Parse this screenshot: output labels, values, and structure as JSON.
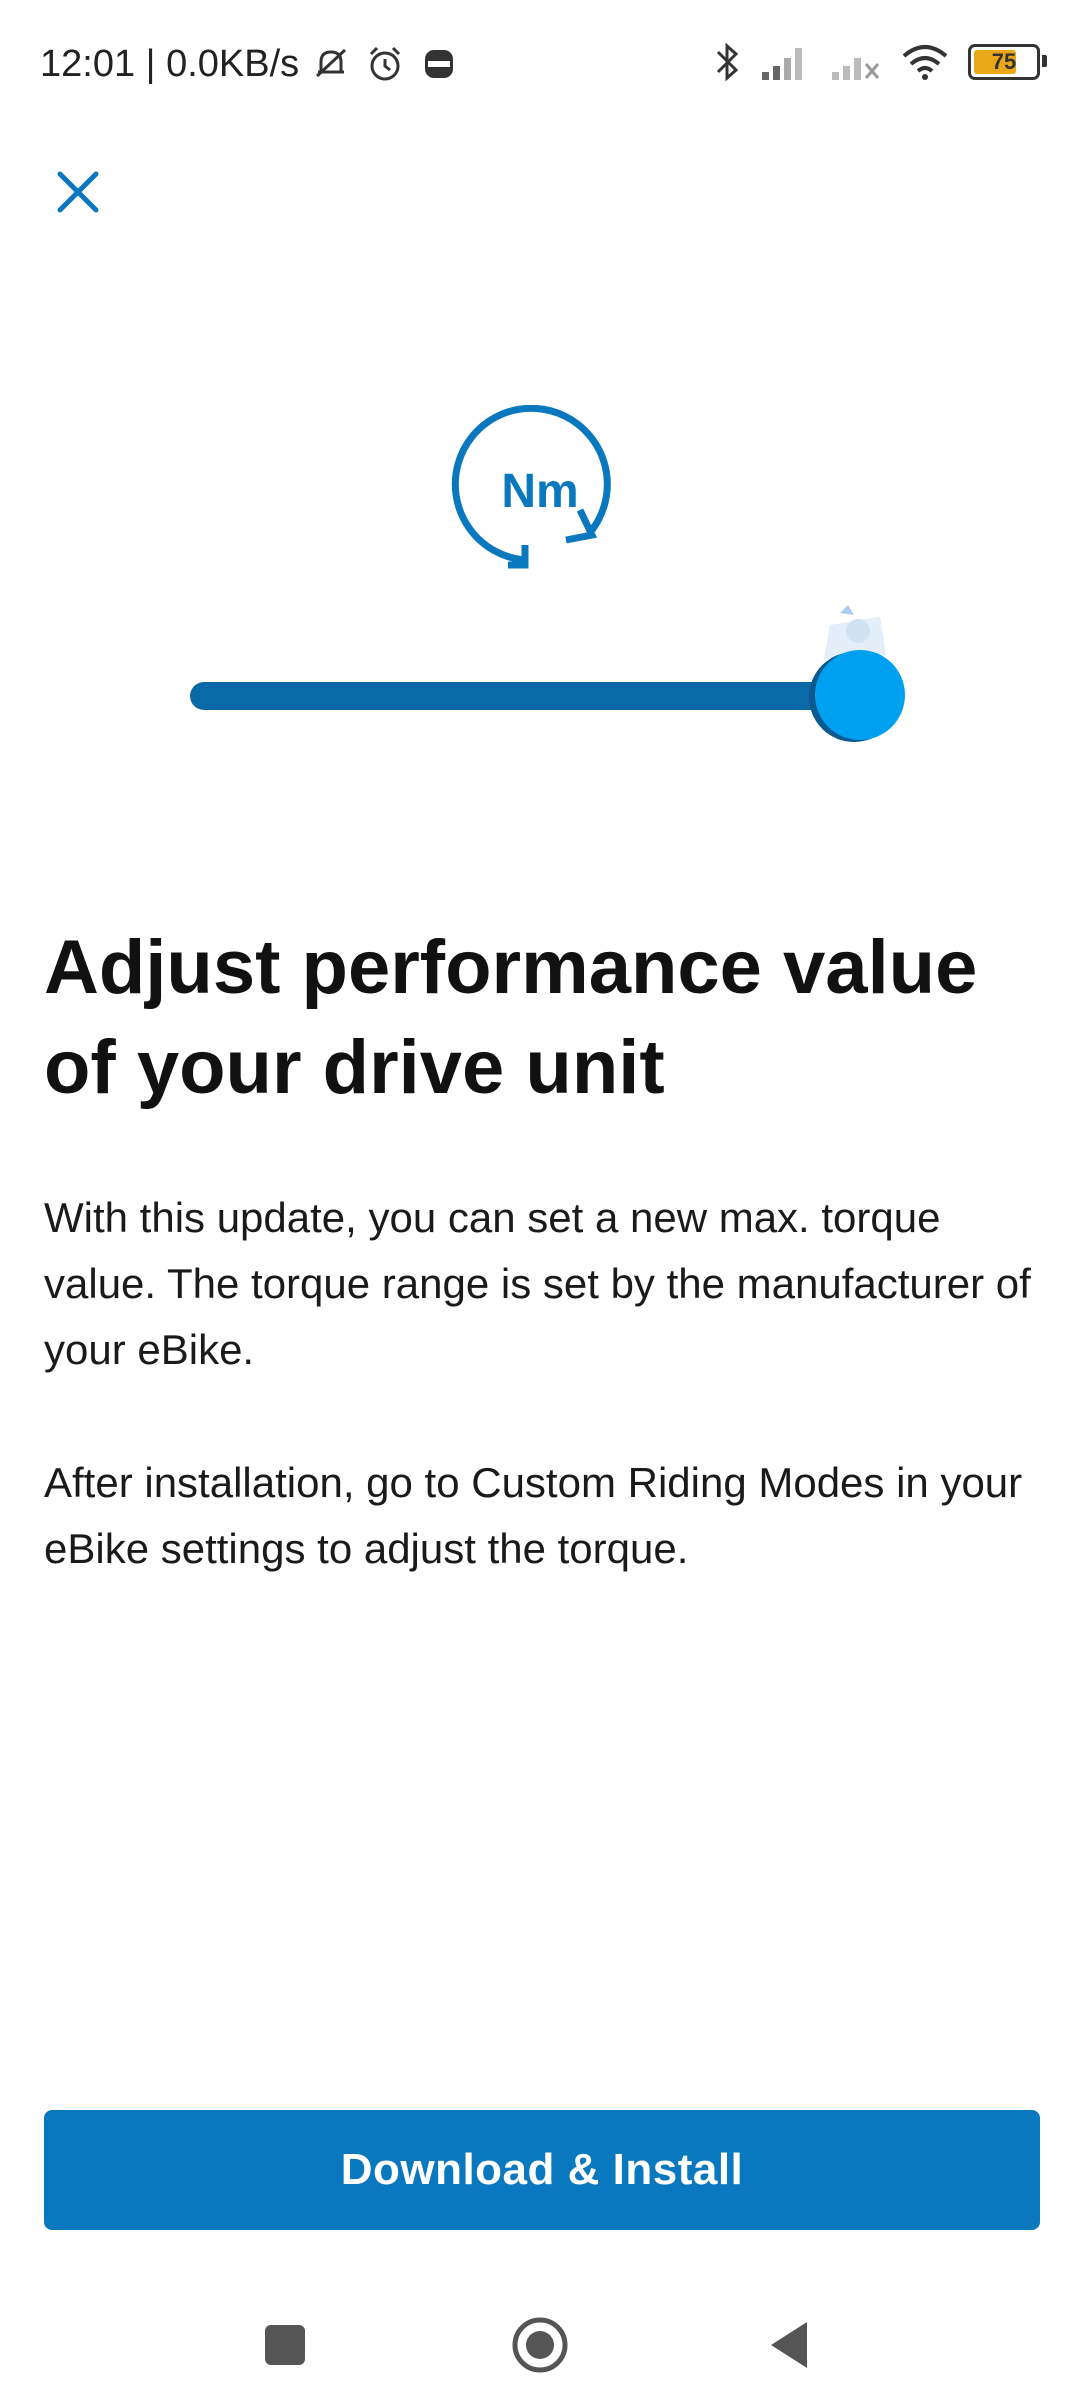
{
  "status_bar": {
    "time_network": "12:01 | 0.0KB/s",
    "battery_level": "75",
    "battery_fraction": 0.75,
    "icons": [
      "mute-bell-icon",
      "alarm-icon",
      "burger-king-app-icon",
      "bluetooth-icon",
      "signal-icon",
      "signal-no-service-icon",
      "wifi-icon",
      "battery-icon"
    ]
  },
  "header": {
    "close_icon": "close-icon"
  },
  "illustration": {
    "unit_label": "Nm",
    "slider_level": 1.0
  },
  "content": {
    "title": "Adjust performance value of your drive unit",
    "paragraph_1": "With this update, you can set a new max. torque value. The torque range is set by the manufacturer of your eBike.",
    "paragraph_2": "After installation, go to Custom Riding Modes in your eBike settings to adjust the torque."
  },
  "action": {
    "button_label": "Download & Install"
  },
  "nav_bar": {
    "icons": [
      "recents-square-icon",
      "home-circle-icon",
      "back-triangle-icon"
    ]
  },
  "colors": {
    "primary": "#0a78be",
    "accent": "#00a0f0",
    "track": "#0a6aa8"
  }
}
